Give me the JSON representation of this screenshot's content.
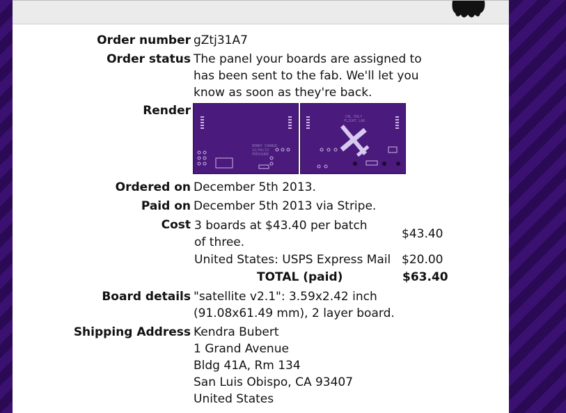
{
  "order": {
    "number_label": "Order number",
    "number_value": "gZtj31A7",
    "status_label": "Order status",
    "status_value": "The panel your boards are assigned to has been sent to the fab. We'll let you know as soon as they're back.",
    "render_label": "Render",
    "ordered_label": "Ordered on",
    "ordered_value": "December 5th 2013.",
    "paid_label": "Paid on",
    "paid_value": "December 5th 2013 via Stripe.",
    "cost_label": "Cost",
    "cost_items": [
      {
        "desc": "3 boards at $43.40 per batch of three.",
        "amount": "$43.40"
      },
      {
        "desc": "United States: USPS Express Mail",
        "amount": "$20.00"
      }
    ],
    "total_label": "TOTAL (paid)",
    "total_value": "$63.40",
    "details_label": "Board details",
    "details_value": "\"satellite v2.1\": 3.59x2.42 inch (91.08x61.49 mm), 2 layer board.",
    "shipping_label": "Shipping Address",
    "shipping_lines": [
      "Kendra Bubert",
      "1 Grand Avenue",
      "Bldg 41A, Rm 134",
      "San Luis Obispo, CA 93407",
      "United States"
    ]
  },
  "colors": {
    "board": "#4a1a7c",
    "stripe_dark": "#2a0a55",
    "stripe_light": "#3a1170"
  },
  "icons": [
    "mascot-icon"
  ]
}
